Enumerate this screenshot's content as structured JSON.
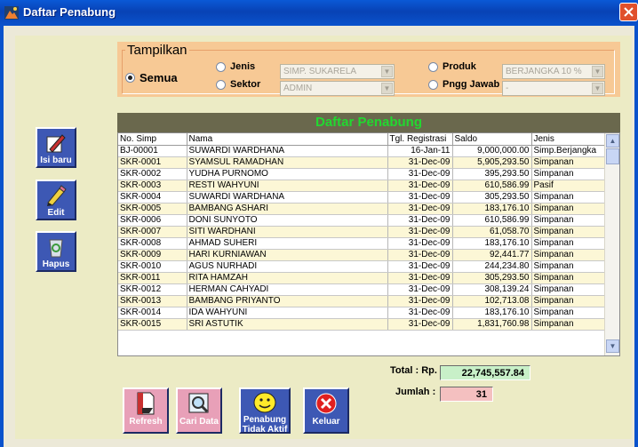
{
  "window": {
    "title": "Daftar Penabung"
  },
  "filter": {
    "legend": "Tampilkan",
    "semua_label": "Semua",
    "jenis_label": "Jenis",
    "jenis_value": "SIMP. SUKARELA",
    "sektor_label": "Sektor",
    "sektor_value": "ADMIN",
    "produk_label": "Produk",
    "produk_value": "BERJANGKA 10 %",
    "pngg_label": "Pngg Jawab",
    "pngg_value": "-"
  },
  "side": {
    "isi_baru": "Isi baru",
    "edit": "Edit",
    "hapus": "Hapus"
  },
  "grid": {
    "title": "Daftar Penabung",
    "columns": [
      "No. Simp",
      "Nama",
      "Tgl. Registrasi",
      "Saldo",
      "Jenis"
    ],
    "rows": [
      [
        "BJ-00001",
        "SUWARDI WARDHANA",
        "16-Jan-11",
        "9,000,000.00",
        "Simp.Berjangka"
      ],
      [
        "SKR-0001",
        "SYAMSUL RAMADHAN",
        "31-Dec-09",
        "5,905,293.50",
        "Simpanan"
      ],
      [
        "SKR-0002",
        "YUDHA PURNOMO",
        "31-Dec-09",
        "395,293.50",
        "Simpanan"
      ],
      [
        "SKR-0003",
        "RESTI WAHYUNI",
        "31-Dec-09",
        "610,586.99",
        "Pasif"
      ],
      [
        "SKR-0004",
        "SUWARDI WARDHANA",
        "31-Dec-09",
        "305,293.50",
        "Simpanan"
      ],
      [
        "SKR-0005",
        "BAMBANG ASHARI",
        "31-Dec-09",
        "183,176.10",
        "Simpanan"
      ],
      [
        "SKR-0006",
        "DONI SUNYOTO",
        "31-Dec-09",
        "610,586.99",
        "Simpanan"
      ],
      [
        "SKR-0007",
        "SITI WARDHANI",
        "31-Dec-09",
        "61,058.70",
        "Simpanan"
      ],
      [
        "SKR-0008",
        "AHMAD SUHERI",
        "31-Dec-09",
        "183,176.10",
        "Simpanan"
      ],
      [
        "SKR-0009",
        "HARI KURNIAWAN",
        "31-Dec-09",
        "92,441.77",
        "Simpanan"
      ],
      [
        "SKR-0010",
        "AGUS NURHADI",
        "31-Dec-09",
        "244,234.80",
        "Simpanan"
      ],
      [
        "SKR-0011",
        "RITA HAMZAH",
        "31-Dec-09",
        "305,293.50",
        "Simpanan"
      ],
      [
        "SKR-0012",
        "HERMAN CAHYADI",
        "31-Dec-09",
        "308,139.24",
        "Simpanan"
      ],
      [
        "SKR-0013",
        "BAMBANG PRIYANTO",
        "31-Dec-09",
        "102,713.08",
        "Simpanan"
      ],
      [
        "SKR-0014",
        "IDA WAHYUNI",
        "31-Dec-09",
        "183,176.10",
        "Simpanan"
      ],
      [
        "SKR-0015",
        "SRI ASTUTIK",
        "31-Dec-09",
        "1,831,760.98",
        "Simpanan"
      ]
    ]
  },
  "totals": {
    "total_label": "Total : Rp.",
    "total_value": "22,745,557.84",
    "jumlah_label": "Jumlah :",
    "jumlah_value": "31"
  },
  "buttons": {
    "refresh": "Refresh",
    "cari": "Cari Data",
    "penabung_line1": "Penabung",
    "penabung_line2": "Tidak Aktif",
    "keluar": "Keluar"
  },
  "colors": {
    "titlebar": "#0a52cc",
    "client_bg": "#ecebc5",
    "filter_bg": "#f7c995",
    "grid_header": "#6a684d",
    "grid_title": "#22d830",
    "button_blue": "#3d58b4",
    "total_box": "#c8f0c8",
    "jumlah_box": "#f4c0c0"
  }
}
